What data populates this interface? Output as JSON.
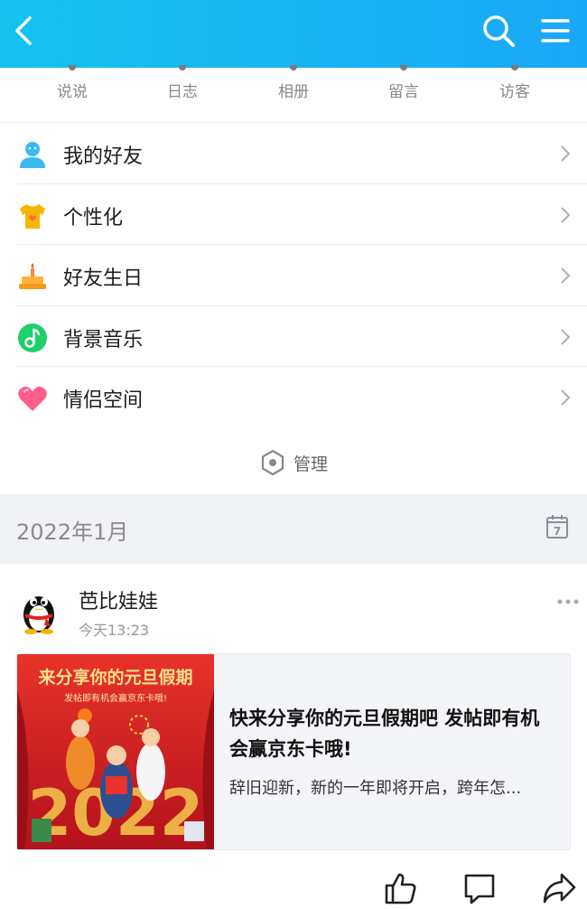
{
  "header": {
    "back_icon": "chevron-left-icon",
    "search_icon": "search-icon",
    "menu_icon": "hamburger-menu-icon",
    "gradient": [
      "#14c2f0",
      "#1aa7f7"
    ]
  },
  "quicknav": {
    "items": [
      {
        "label": "说说"
      },
      {
        "label": "日志"
      },
      {
        "label": "相册"
      },
      {
        "label": "留言"
      },
      {
        "label": "访客"
      }
    ]
  },
  "menu": {
    "items": [
      {
        "label": "我的好友",
        "icon": "person-icon",
        "color": "#3cb8f2"
      },
      {
        "label": "个性化",
        "icon": "tshirt-icon",
        "color": "#f7b500"
      },
      {
        "label": "好友生日",
        "icon": "birthday-cake-icon",
        "color": "#f6a623"
      },
      {
        "label": "背景音乐",
        "icon": "music-note-icon",
        "color": "#1ecf6b"
      },
      {
        "label": "情侣空间",
        "icon": "heart-icon",
        "color": "#ff5d8a"
      }
    ]
  },
  "manage": {
    "label": "管理",
    "icon": "hexagon-settings-icon"
  },
  "date_section": {
    "label": "2022年1月",
    "calendar_icon": "calendar-icon",
    "calendar_day": "7"
  },
  "post": {
    "author": "芭比娃娃",
    "time": "今天13:23",
    "more_icon": "more-dots-icon",
    "card": {
      "image_banner": "来分享你的元旦假期",
      "image_subline": "发帖即有机会赢京东卡哦!",
      "image_year": "2022",
      "title": "快来分享你的元旦假期吧 发帖即有机会赢京东卡哦!",
      "description": "辞旧迎新，新的一年即将开启，跨年怎..."
    },
    "actions": [
      {
        "name": "like-button",
        "icon": "thumbs-up-icon"
      },
      {
        "name": "comment-button",
        "icon": "comment-icon"
      },
      {
        "name": "share-button",
        "icon": "share-icon"
      }
    ]
  }
}
